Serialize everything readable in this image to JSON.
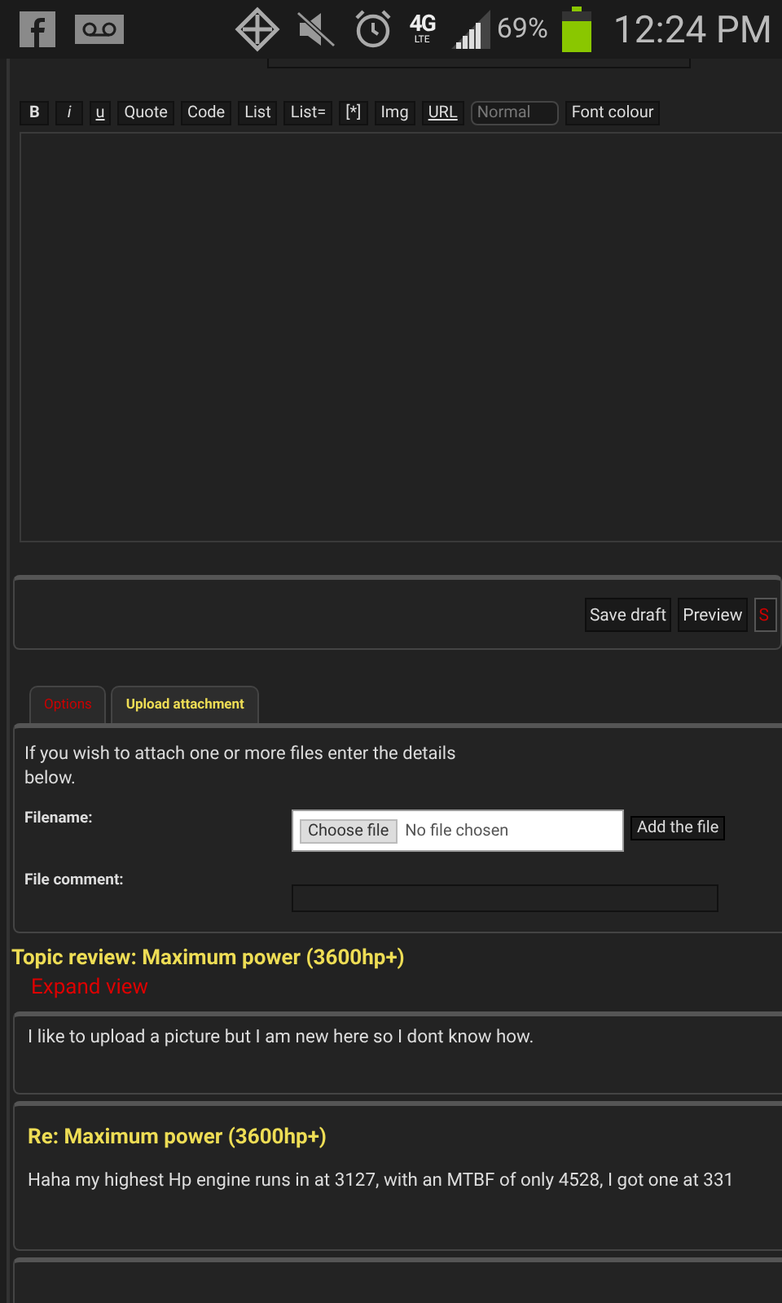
{
  "status_bar": {
    "network": "4G",
    "network_sub": "LTE",
    "battery_text": "69%",
    "time": "12:24 PM"
  },
  "editor": {
    "toolbar": [
      {
        "label": "B",
        "kind": "bold"
      },
      {
        "label": "i",
        "kind": "italic"
      },
      {
        "label": "u",
        "kind": "underline"
      },
      {
        "label": "Quote",
        "kind": "plain"
      },
      {
        "label": "Code",
        "kind": "plain"
      },
      {
        "label": "List",
        "kind": "plain"
      },
      {
        "label": "List=",
        "kind": "plain"
      },
      {
        "label": "[*]",
        "kind": "plain"
      },
      {
        "label": "Img",
        "kind": "plain"
      },
      {
        "label": "URL",
        "kind": "underline"
      },
      {
        "label": "Normal",
        "kind": "select"
      },
      {
        "label": "Font colour",
        "kind": "plain"
      }
    ]
  },
  "form_buttons": [
    {
      "label": "Save draft",
      "kind": "normal"
    },
    {
      "label": "Preview",
      "kind": "normal"
    },
    {
      "label": "S",
      "kind": "submit"
    }
  ],
  "tabs": [
    {
      "label": "Options",
      "selected": false
    },
    {
      "label": "Upload attachment",
      "selected": true
    }
  ],
  "attachment": {
    "intro": "If you wish to attach one or more files enter the details below.",
    "filename_label": "Filename:",
    "choose_button": "Choose file",
    "file_status": "No file chosen",
    "add_button": "Add the file",
    "comment_label": "File comment:"
  },
  "topic_review": {
    "title": "Topic review: Maximum power (3600hp+)",
    "expand_link": "Expand view"
  },
  "posts": [
    {
      "body": "I like to upload a picture but I am new here so I dont know how."
    },
    {
      "title": "Re: Maximum power (3600hp+)",
      "body": "Haha my highest Hp engine runs in at 3127, with an MTBF of only 4528, I got one at 331"
    }
  ]
}
